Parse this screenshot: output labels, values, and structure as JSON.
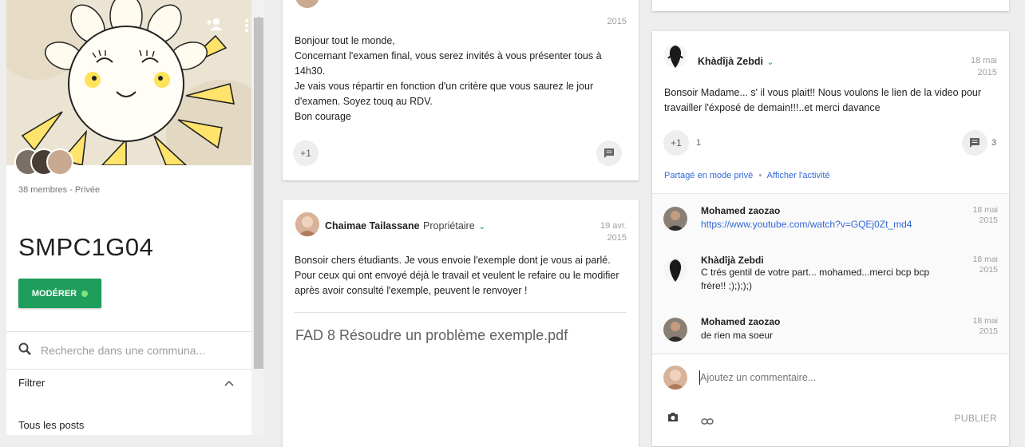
{
  "sidebar": {
    "members_text": "38 membres - Privée",
    "group_title": "SMPC1G04",
    "moderate_label": "MODÉRER",
    "search_placeholder": "Recherche dans une communa...",
    "filter_label": "Filtrer",
    "all_posts_label": "Tous les posts",
    "icons": [
      "add-person-icon",
      "more-vert-icon",
      "search-icon",
      "chevron-up-icon"
    ]
  },
  "top_card": {
    "date_year": "2015",
    "text_lines": [
      "Bonjour tout le monde,",
      "Concernant l'examen final, vous serez invités à vous présenter tous à",
      "14h30.",
      "Je vais vous répartir en fonction d'un critère que vous saurez le jour",
      "d'examen.  Soyez touq au RDV.",
      "Bon courage"
    ],
    "plus_one": "+1"
  },
  "second_card": {
    "author": "Chaimae Tailassane",
    "role": "Propriétaire",
    "date_day": "19 avr.",
    "date_year": "2015",
    "text_lines": [
      "Bonsoir chers étudiants. Je vous envoie l'exemple dont je vous ai parlé.",
      "Pour ceux qui ont envoyé  déjà le travail et veulent  le refaire ou le modifier",
      "après  avoir consulté  l'exemple, peuvent le renvoyer !"
    ],
    "attachment": "FAD 8 Résoudre un problème exemple.pdf"
  },
  "right_card": {
    "author": "Khàdîjà Zebdi",
    "date_day": "18 mai",
    "date_year": "2015",
    "text_lines": [
      "Bonsoir Madame... s' il vous plait!! Nous voulons le lien de la video pour",
      "travailler l'éxposé de demain!!!..et merci davance"
    ],
    "plus_one": "+1",
    "plus_one_count": "1",
    "comment_count": "3",
    "shared_private": "Partagé en mode privé",
    "separator": "•",
    "show_activity": "Afficher l'activité",
    "comments": [
      {
        "author": "Mohamed zaozao",
        "text": "https://www.youtube.com/watch?v=GQEj0Zt_md4",
        "date_day": "18 mai",
        "date_year": "2015"
      },
      {
        "author": "Khàdîjà Zebdi",
        "text": "C trés gentil de votre part... mohamed...merci bcp bcp frère!! ;);););)",
        "date_day": "18 mai",
        "date_year": "2015"
      },
      {
        "author": "Mohamed zaozao",
        "text": "de rien  ma soeur",
        "date_day": "18 mai",
        "date_year": "2015"
      }
    ],
    "comment_placeholder": "Ajoutez un commentaire...",
    "publish_label": "PUBLIER"
  },
  "colors": {
    "accent_green": "#1e9e5a",
    "link_blue": "#3367d6",
    "background": "#eeeeee"
  }
}
